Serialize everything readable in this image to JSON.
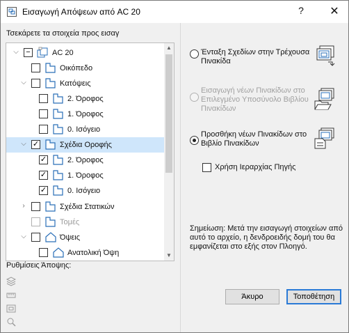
{
  "window": {
    "title": "Εισαγωγή Απόψεων από AC 20",
    "help_label": "?",
    "close_label": "✕"
  },
  "left": {
    "choose_label": "Τσεκάρετε τα στοιχεία προς εισαγ",
    "tree": [
      {
        "label": "AC 20",
        "expander": "collapse",
        "check": "partial",
        "icon": "project-icon",
        "selected": false,
        "disabled": false
      },
      {
        "label": "Οικόπεδο",
        "expander": "none",
        "check": "unchecked",
        "icon": "folder-view-icon",
        "selected": false,
        "disabled": false
      },
      {
        "label": "Κατόψεις",
        "expander": "collapse",
        "check": "unchecked",
        "icon": "folder-view-icon",
        "selected": false,
        "disabled": false
      },
      {
        "label": "2. Όροφος",
        "expander": "none",
        "check": "unchecked",
        "icon": "folder-view-icon",
        "selected": false,
        "disabled": false
      },
      {
        "label": "1. Όροφος",
        "expander": "none",
        "check": "unchecked",
        "icon": "folder-view-icon",
        "selected": false,
        "disabled": false
      },
      {
        "label": "0. Ισόγειο",
        "expander": "none",
        "check": "unchecked",
        "icon": "folder-view-icon",
        "selected": false,
        "disabled": false
      },
      {
        "label": "Σχέδια Οροφής",
        "expander": "collapse",
        "check": "checked",
        "icon": "folder-view-icon",
        "selected": true,
        "disabled": false
      },
      {
        "label": "2. Όροφος",
        "expander": "none",
        "check": "checked",
        "icon": "folder-view-icon",
        "selected": false,
        "disabled": false
      },
      {
        "label": "1. Όροφος",
        "expander": "none",
        "check": "checked",
        "icon": "folder-view-icon",
        "selected": false,
        "disabled": false
      },
      {
        "label": "0. Ισόγειο",
        "expander": "none",
        "check": "checked",
        "icon": "folder-view-icon",
        "selected": false,
        "disabled": false
      },
      {
        "label": "Σχέδια Στατικών",
        "expander": "expand",
        "check": "unchecked",
        "icon": "folder-view-icon",
        "selected": false,
        "disabled": false
      },
      {
        "label": "Τομές",
        "expander": "none",
        "check": "unchecked",
        "icon": "folder-view-icon",
        "selected": false,
        "disabled": true
      },
      {
        "label": "Όψεις",
        "expander": "collapse",
        "check": "unchecked",
        "icon": "elevation-icon",
        "selected": false,
        "disabled": false
      },
      {
        "label": "Ανατολική Όψη",
        "expander": "none",
        "check": "unchecked",
        "icon": "elevation-icon",
        "selected": false,
        "disabled": false
      }
    ],
    "view_settings_label": "Ρυθμίσεις Άποψης:",
    "view_settings_icons": [
      "layers-icon",
      "dimension-icon",
      "frame-icon",
      "zoom-icon"
    ]
  },
  "right": {
    "options": [
      {
        "label": "Ένταξη Σχεδίων στην Τρέχουσα Πινακίδα",
        "checked": false,
        "disabled": false,
        "icon": "merge-layouts-icon"
      },
      {
        "label": "Εισαγωγή νέων Πινακίδων στο Επιλεγμένο Υποσύνολο Βιβλίου Πινακίδων",
        "checked": false,
        "disabled": true,
        "icon": "import-to-subset-icon"
      },
      {
        "label": "Προσθήκη νέων Πινακίδων στο Βιβλίο Πινακίδων",
        "checked": true,
        "disabled": false,
        "icon": "add-to-book-icon"
      }
    ],
    "source_hierarchy_label": "Χρήση Ιεραρχίας Πηγής",
    "note": "Σημείωση: Μετά την εισαγωγή στοιχείων από αυτό το αρχείο, η δενδροειδής δομή του θα εμφανίζεται στο εξής στον Πλοηγό."
  },
  "buttons": {
    "cancel": "Άκυρο",
    "place": "Τοποθέτηση"
  },
  "colors": {
    "selection": "#cfe6fb",
    "icon_blue": "#2a6fb8",
    "default_button_border": "#2a7ad6"
  }
}
